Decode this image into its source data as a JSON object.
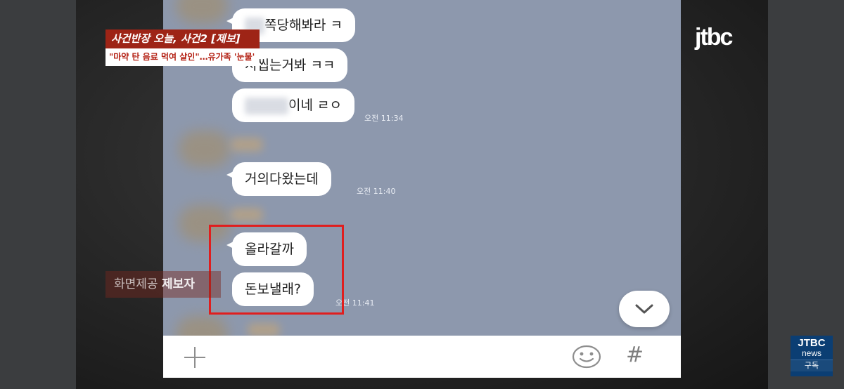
{
  "broadcast": {
    "channel_logo": "jtbc",
    "headline": "사건반장 오늘, 사건2 [제보]",
    "subhead": "\"마약 탄 음료 먹여 살인\"…유가족 '눈물'",
    "credit_prefix": "화면제공",
    "credit_source": "제보자",
    "badge": {
      "line1": "JTBC",
      "line2": "news",
      "line3": "구독"
    }
  },
  "chat": {
    "messages": [
      {
        "text": "쪽당해봐라 ㅋ"
      },
      {
        "text": "시씹는거봐 ㅋㅋ"
      },
      {
        "text": "이네 ㄹㅇ",
        "time": "오전 11:34"
      },
      {
        "text": "거의다왔는데",
        "time": "오전 11:40"
      },
      {
        "text": "올라갈까"
      },
      {
        "text": "돈보낼래?",
        "time": "오전 11:41"
      }
    ]
  },
  "input_bar": {
    "plus_icon": "plus-icon",
    "emoji_icon": "emoji-icon",
    "hash_label": "#"
  },
  "colors": {
    "chat_background": "#8d98ad",
    "highlight": "#e01e1e",
    "headline_bg": "#9e2416"
  }
}
